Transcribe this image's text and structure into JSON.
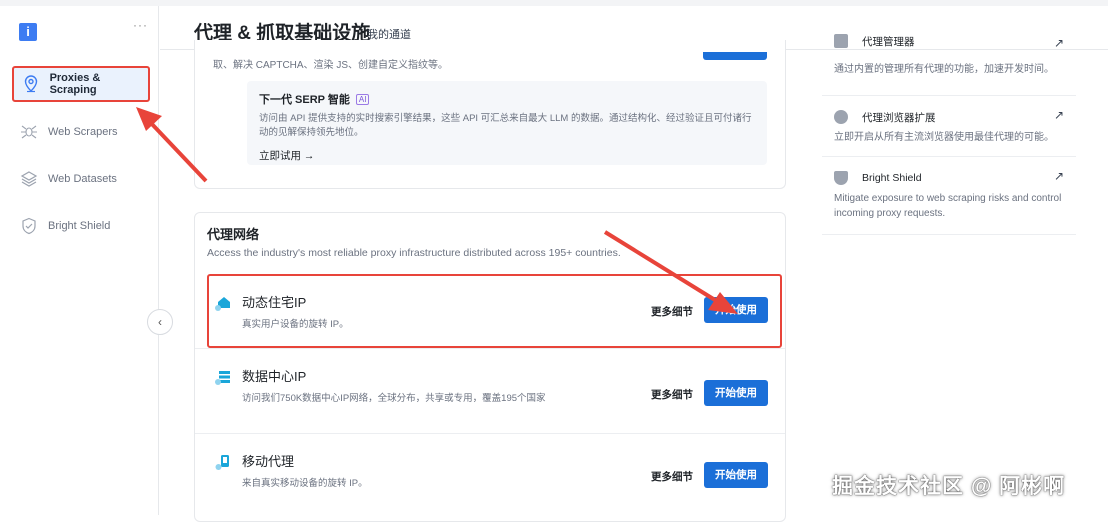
{
  "sidebar": {
    "logo": "i",
    "more": "···",
    "items": [
      {
        "label": "Proxies & Scraping",
        "icon": "location-pin-icon",
        "active": true
      },
      {
        "label": "Web Scrapers",
        "icon": "spider-icon"
      },
      {
        "label": "Web Datasets",
        "icon": "layers-icon"
      },
      {
        "label": "Bright Shield",
        "icon": "shield-check-icon"
      }
    ]
  },
  "header": {
    "title": "代理 & 抓取基础设施",
    "subtitle": "我的通道"
  },
  "top_card": {
    "text": "取、解决 CAPTCHA、渲染 JS、创建自定义指纹等。",
    "serp": {
      "title": "下一代 SERP 智能",
      "badge": "AI",
      "desc": "访问由 API 提供支持的实时搜索引擎结果，这些 API 可汇总来自最大 LLM 的数据。通过结构化、经过验证且可付诸行动的见解保持领先地位。",
      "link": "立即试用 →"
    }
  },
  "proxy_network": {
    "title": "代理网络",
    "desc": "Access the industry's most reliable proxy infrastructure distributed across 195+ countries.",
    "rows": [
      {
        "title": "动态住宅IP",
        "desc": "真实用户设备的旋转 IP。",
        "more": "更多细节",
        "action": "开始使用"
      },
      {
        "title": "数据中心IP",
        "desc": "访问我们750K数据中心IP网络，全球分布，共享或专用，覆盖195个国家",
        "more": "更多细节",
        "action": "开始使用"
      },
      {
        "title": "移动代理",
        "desc": "来自真实移动设备的旋转 IP。",
        "more": "更多细节",
        "action": "开始使用"
      }
    ]
  },
  "right_panel": [
    {
      "title": "代理管理器",
      "desc": "通过内置的管理所有代理的功能，加速开发时间。"
    },
    {
      "title": "代理浏览器扩展",
      "desc": "立即开启从所有主流浏览器使用最佳代理的可能。"
    },
    {
      "title": "Bright Shield",
      "desc": "Mitigate exposure to web scraping risks and control incoming proxy requests."
    }
  ],
  "collapse": "‹",
  "watermark": "掘金技术社区 @ 阿彬啊",
  "colors": {
    "accent": "#1b6fd8",
    "highlight": "#e8443a"
  }
}
